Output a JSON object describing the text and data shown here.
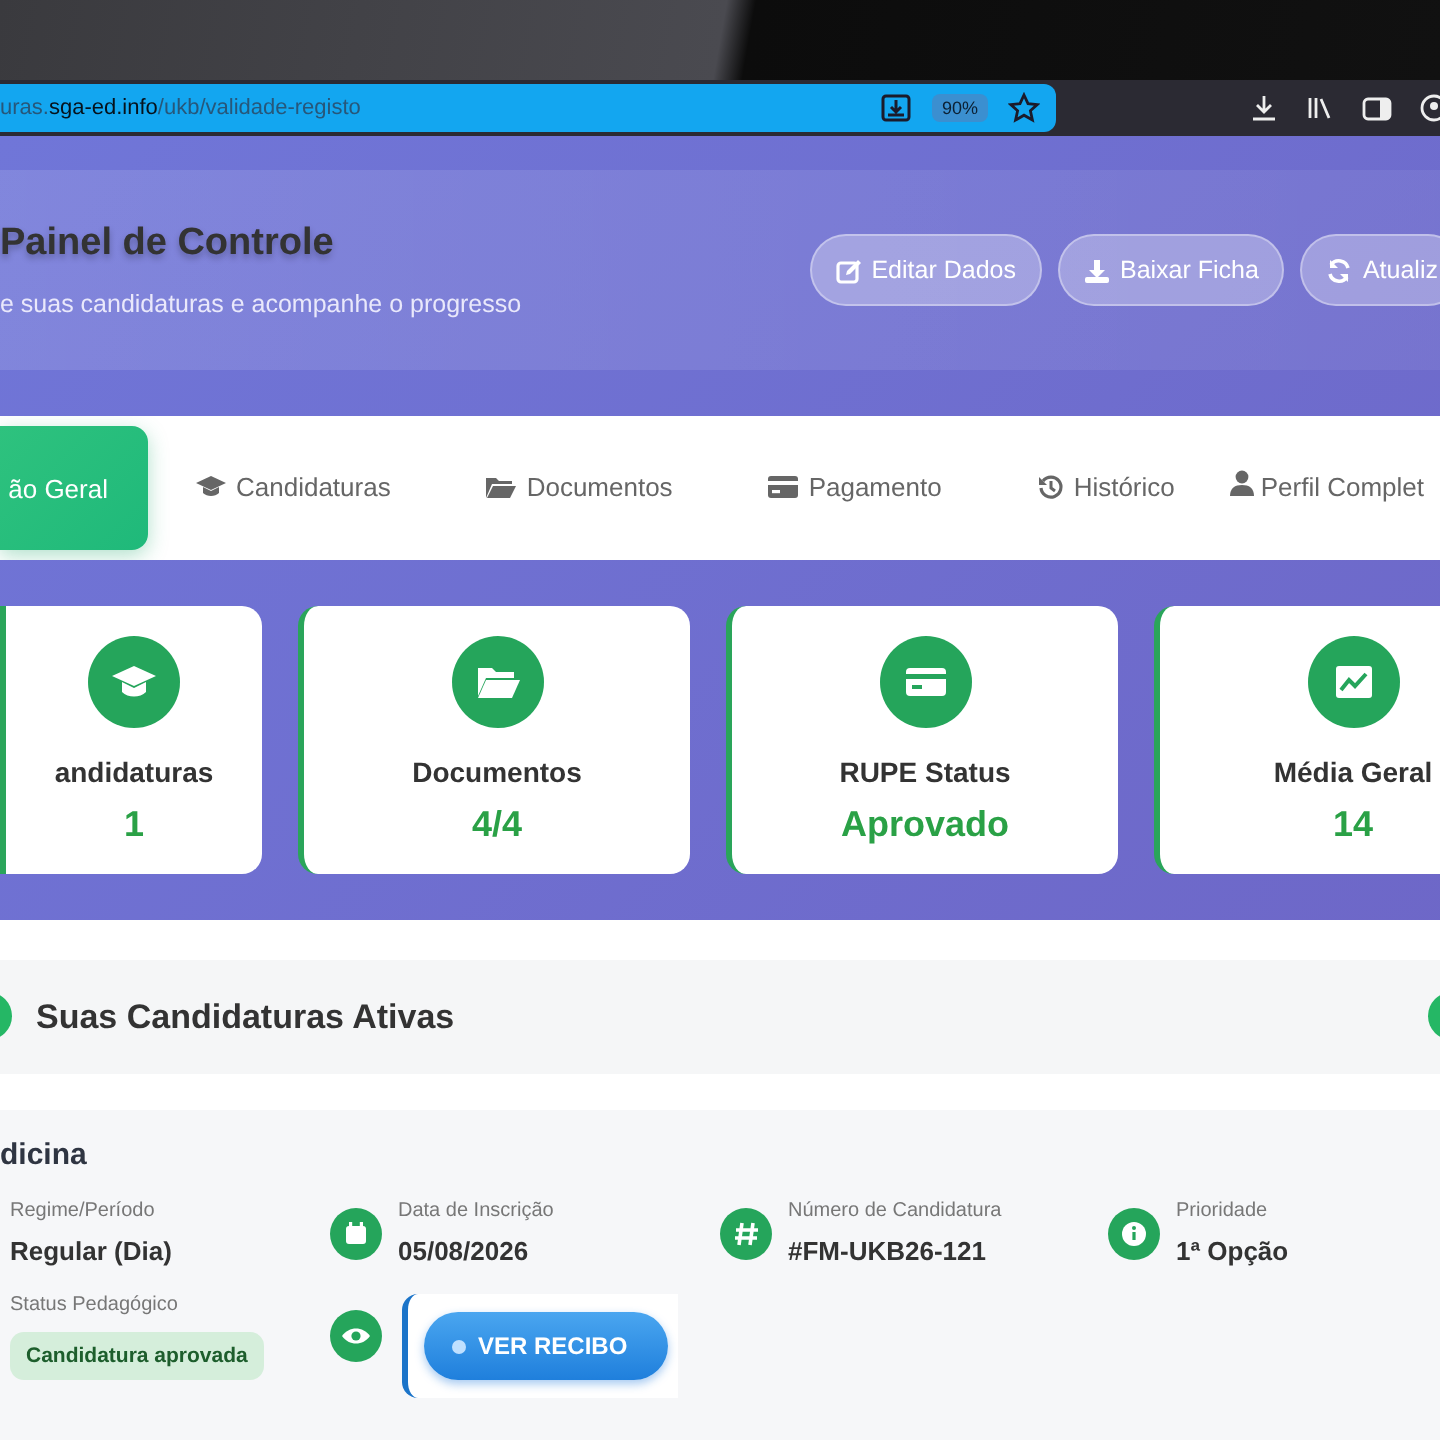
{
  "browser": {
    "url_host": "uras.sga-ed.info",
    "url_path": "/ukb/validade-registo",
    "zoom": "90%"
  },
  "header": {
    "title": "Painel de Controle",
    "subtitle": "e suas candidaturas e acompanhe o progresso",
    "buttons": [
      {
        "label": "Editar Dados"
      },
      {
        "label": "Baixar Ficha"
      },
      {
        "label": "Atualiz"
      }
    ]
  },
  "tabs": [
    {
      "label": "ão Geral",
      "selected": true
    },
    {
      "label": "Candidaturas",
      "selected": false
    },
    {
      "label": "Documentos",
      "selected": false
    },
    {
      "label": "Pagamento",
      "selected": false
    },
    {
      "label": "Histórico",
      "selected": false
    },
    {
      "label": "Perfil Complet",
      "selected": false
    }
  ],
  "stats": [
    {
      "label": "andidaturas",
      "value": "1"
    },
    {
      "label": "Documentos",
      "value": "4/4"
    },
    {
      "label": "RUPE Status",
      "value": "Aprovado"
    },
    {
      "label": "Média Geral",
      "value": "14"
    }
  ],
  "section_title": "Suas Candidaturas Ativas",
  "application": {
    "course": "dicina",
    "fields": [
      {
        "label": "Regime/Período",
        "value": "Regular (Dia)"
      },
      {
        "label": "Data de Inscrição",
        "value": "05/08/2026"
      },
      {
        "label": "Número de Candidatura",
        "value": "#FM-UKB26-121"
      },
      {
        "label": "Prioridade",
        "value": "1ª Opção"
      }
    ],
    "status_label": "Status Pedagógico",
    "status": "Candidatura aprovada",
    "receipt_button": "VER RECIBO"
  }
}
